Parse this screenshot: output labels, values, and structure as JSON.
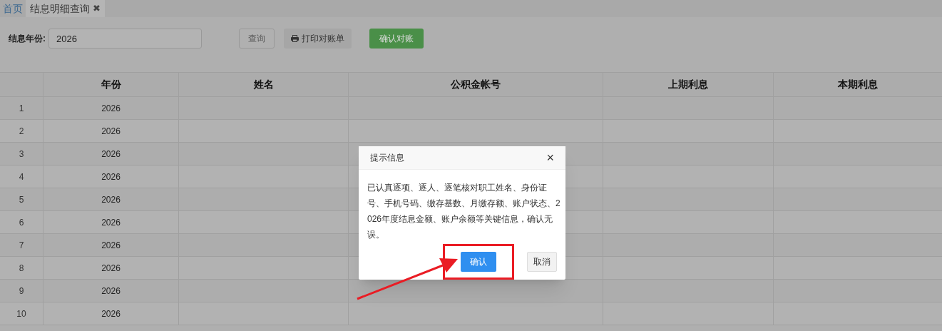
{
  "tabs": [
    {
      "label": "首页",
      "selected": false
    },
    {
      "label": "结息明细查询",
      "selected": true,
      "close_glyph": "✖"
    }
  ],
  "filter": {
    "label": "结息年份:",
    "value": "2026"
  },
  "toolbar_buttons": [
    {
      "label": "查询",
      "kind": "outline"
    },
    {
      "label": "打印对账单",
      "kind": "print"
    },
    {
      "label": "确认对账",
      "kind": "success"
    }
  ],
  "table": {
    "columns": [
      "年份",
      "姓名",
      "公积金帐号",
      "上期利息",
      "本期利息"
    ],
    "rows": [
      {
        "index": "1",
        "year": "2026"
      },
      {
        "index": "2",
        "year": "2026"
      },
      {
        "index": "3",
        "year": "2026"
      },
      {
        "index": "4",
        "year": "2026"
      },
      {
        "index": "5",
        "year": "2026"
      },
      {
        "index": "6",
        "year": "2026"
      },
      {
        "index": "7",
        "year": "2026"
      },
      {
        "index": "8",
        "year": "2026"
      },
      {
        "index": "9",
        "year": "2026"
      },
      {
        "index": "10",
        "year": "2026"
      }
    ]
  },
  "dialog": {
    "title": "提示信息",
    "close_glyph": "×",
    "message": "已认真逐项、逐人、逐笔核对职工姓名、身份证号、手机号码、缴存基数、月缴存额、账户状态、2026年度结息金额、账户余额等关键信息，确认无误。",
    "buttons": [
      {
        "label": "确认",
        "kind": "primary",
        "highlighted": true
      },
      {
        "label": "取消",
        "kind": "default",
        "highlighted": false
      }
    ]
  }
}
